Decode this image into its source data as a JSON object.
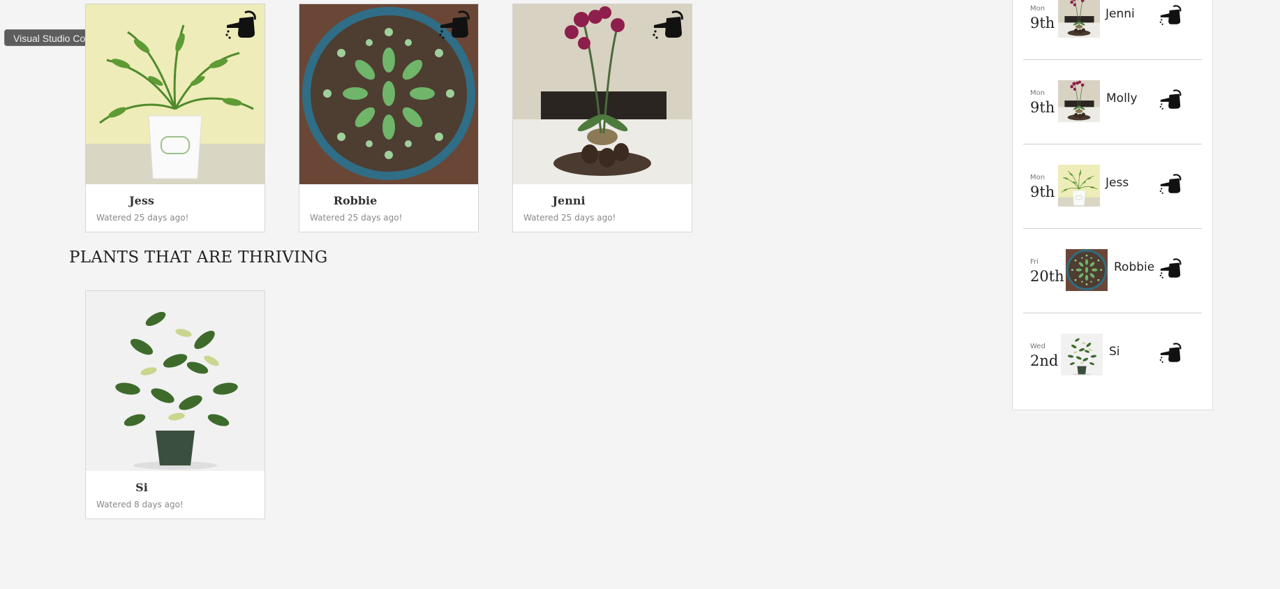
{
  "tooltip": {
    "label": "Visual Studio Code"
  },
  "needs_water": [
    {
      "name": "Jess",
      "watered": "Watered 25 days ago!",
      "icon": "watering-can-icon"
    },
    {
      "name": "Robbie",
      "watered": "Watered 25 days ago!",
      "icon": "watering-can-icon"
    },
    {
      "name": "Jenni",
      "watered": "Watered 25 days ago!",
      "icon": "watering-can-icon"
    }
  ],
  "thriving": {
    "heading": "PLANTS THAT ARE THRIVING",
    "plants": [
      {
        "name": "Si",
        "watered": "Watered 8 days ago!"
      }
    ]
  },
  "schedule": [
    {
      "day_of_week": "Mon",
      "day": "9th",
      "plant": "Jenni",
      "icon": "watering-can-icon"
    },
    {
      "day_of_week": "Mon",
      "day": "9th",
      "plant": "Molly",
      "icon": "watering-can-icon"
    },
    {
      "day_of_week": "Mon",
      "day": "9th",
      "plant": "Jess",
      "icon": "watering-can-icon"
    },
    {
      "day_of_week": "Fri",
      "day": "20th",
      "plant": "Robbie",
      "icon": "watering-can-icon"
    },
    {
      "day_of_week": "Wed",
      "day": "2nd",
      "plant": "Si",
      "icon": "watering-can-icon"
    }
  ],
  "colors": {
    "background": "#f4f4f4",
    "card": "#ffffff",
    "icon": "#111111",
    "muted_text": "#888888"
  }
}
